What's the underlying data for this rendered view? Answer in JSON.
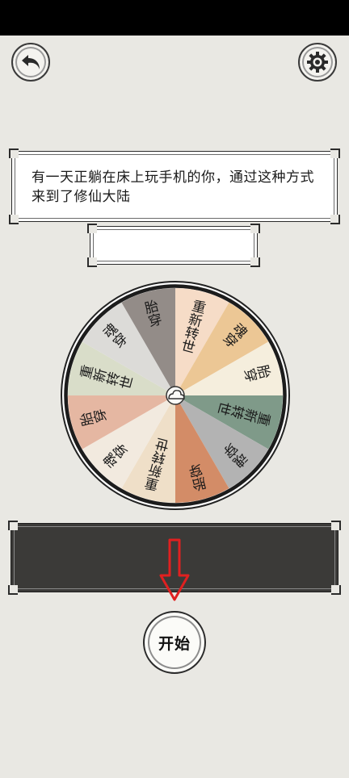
{
  "header": {
    "back_icon": "back-arrow-icon",
    "settings_icon": "gear-icon"
  },
  "story": {
    "text": "有一天正躺在床上玩手机的你，通过这种方式来到了修仙大陆"
  },
  "result": {
    "text": ""
  },
  "wheel": {
    "center_icon": "cloud-ornament-icon",
    "segments": [
      {
        "label": "重新转世",
        "color": "#f6dcc7"
      },
      {
        "label": "魂穿",
        "color": "#ecc795"
      },
      {
        "label": "胎穿",
        "color": "#f5eedd"
      },
      {
        "label": "重新转世",
        "color": "#7f9a89"
      },
      {
        "label": "魂穿",
        "color": "#b3b3b3"
      },
      {
        "label": "胎穿",
        "color": "#d38c67"
      },
      {
        "label": "重新转世",
        "color": "#efdfc8"
      },
      {
        "label": "魂穿",
        "color": "#f2eadf"
      },
      {
        "label": "胎穿",
        "color": "#e5b7a2"
      },
      {
        "label": "重新转世",
        "color": "#d9ddc9"
      },
      {
        "label": "魂穿",
        "color": "#dcdbd8"
      },
      {
        "label": "胎穿",
        "color": "#938c88"
      }
    ]
  },
  "pointer": {
    "color": "#e02020",
    "icon": "down-arrow-icon"
  },
  "actions": {
    "start_label": "开始"
  }
}
